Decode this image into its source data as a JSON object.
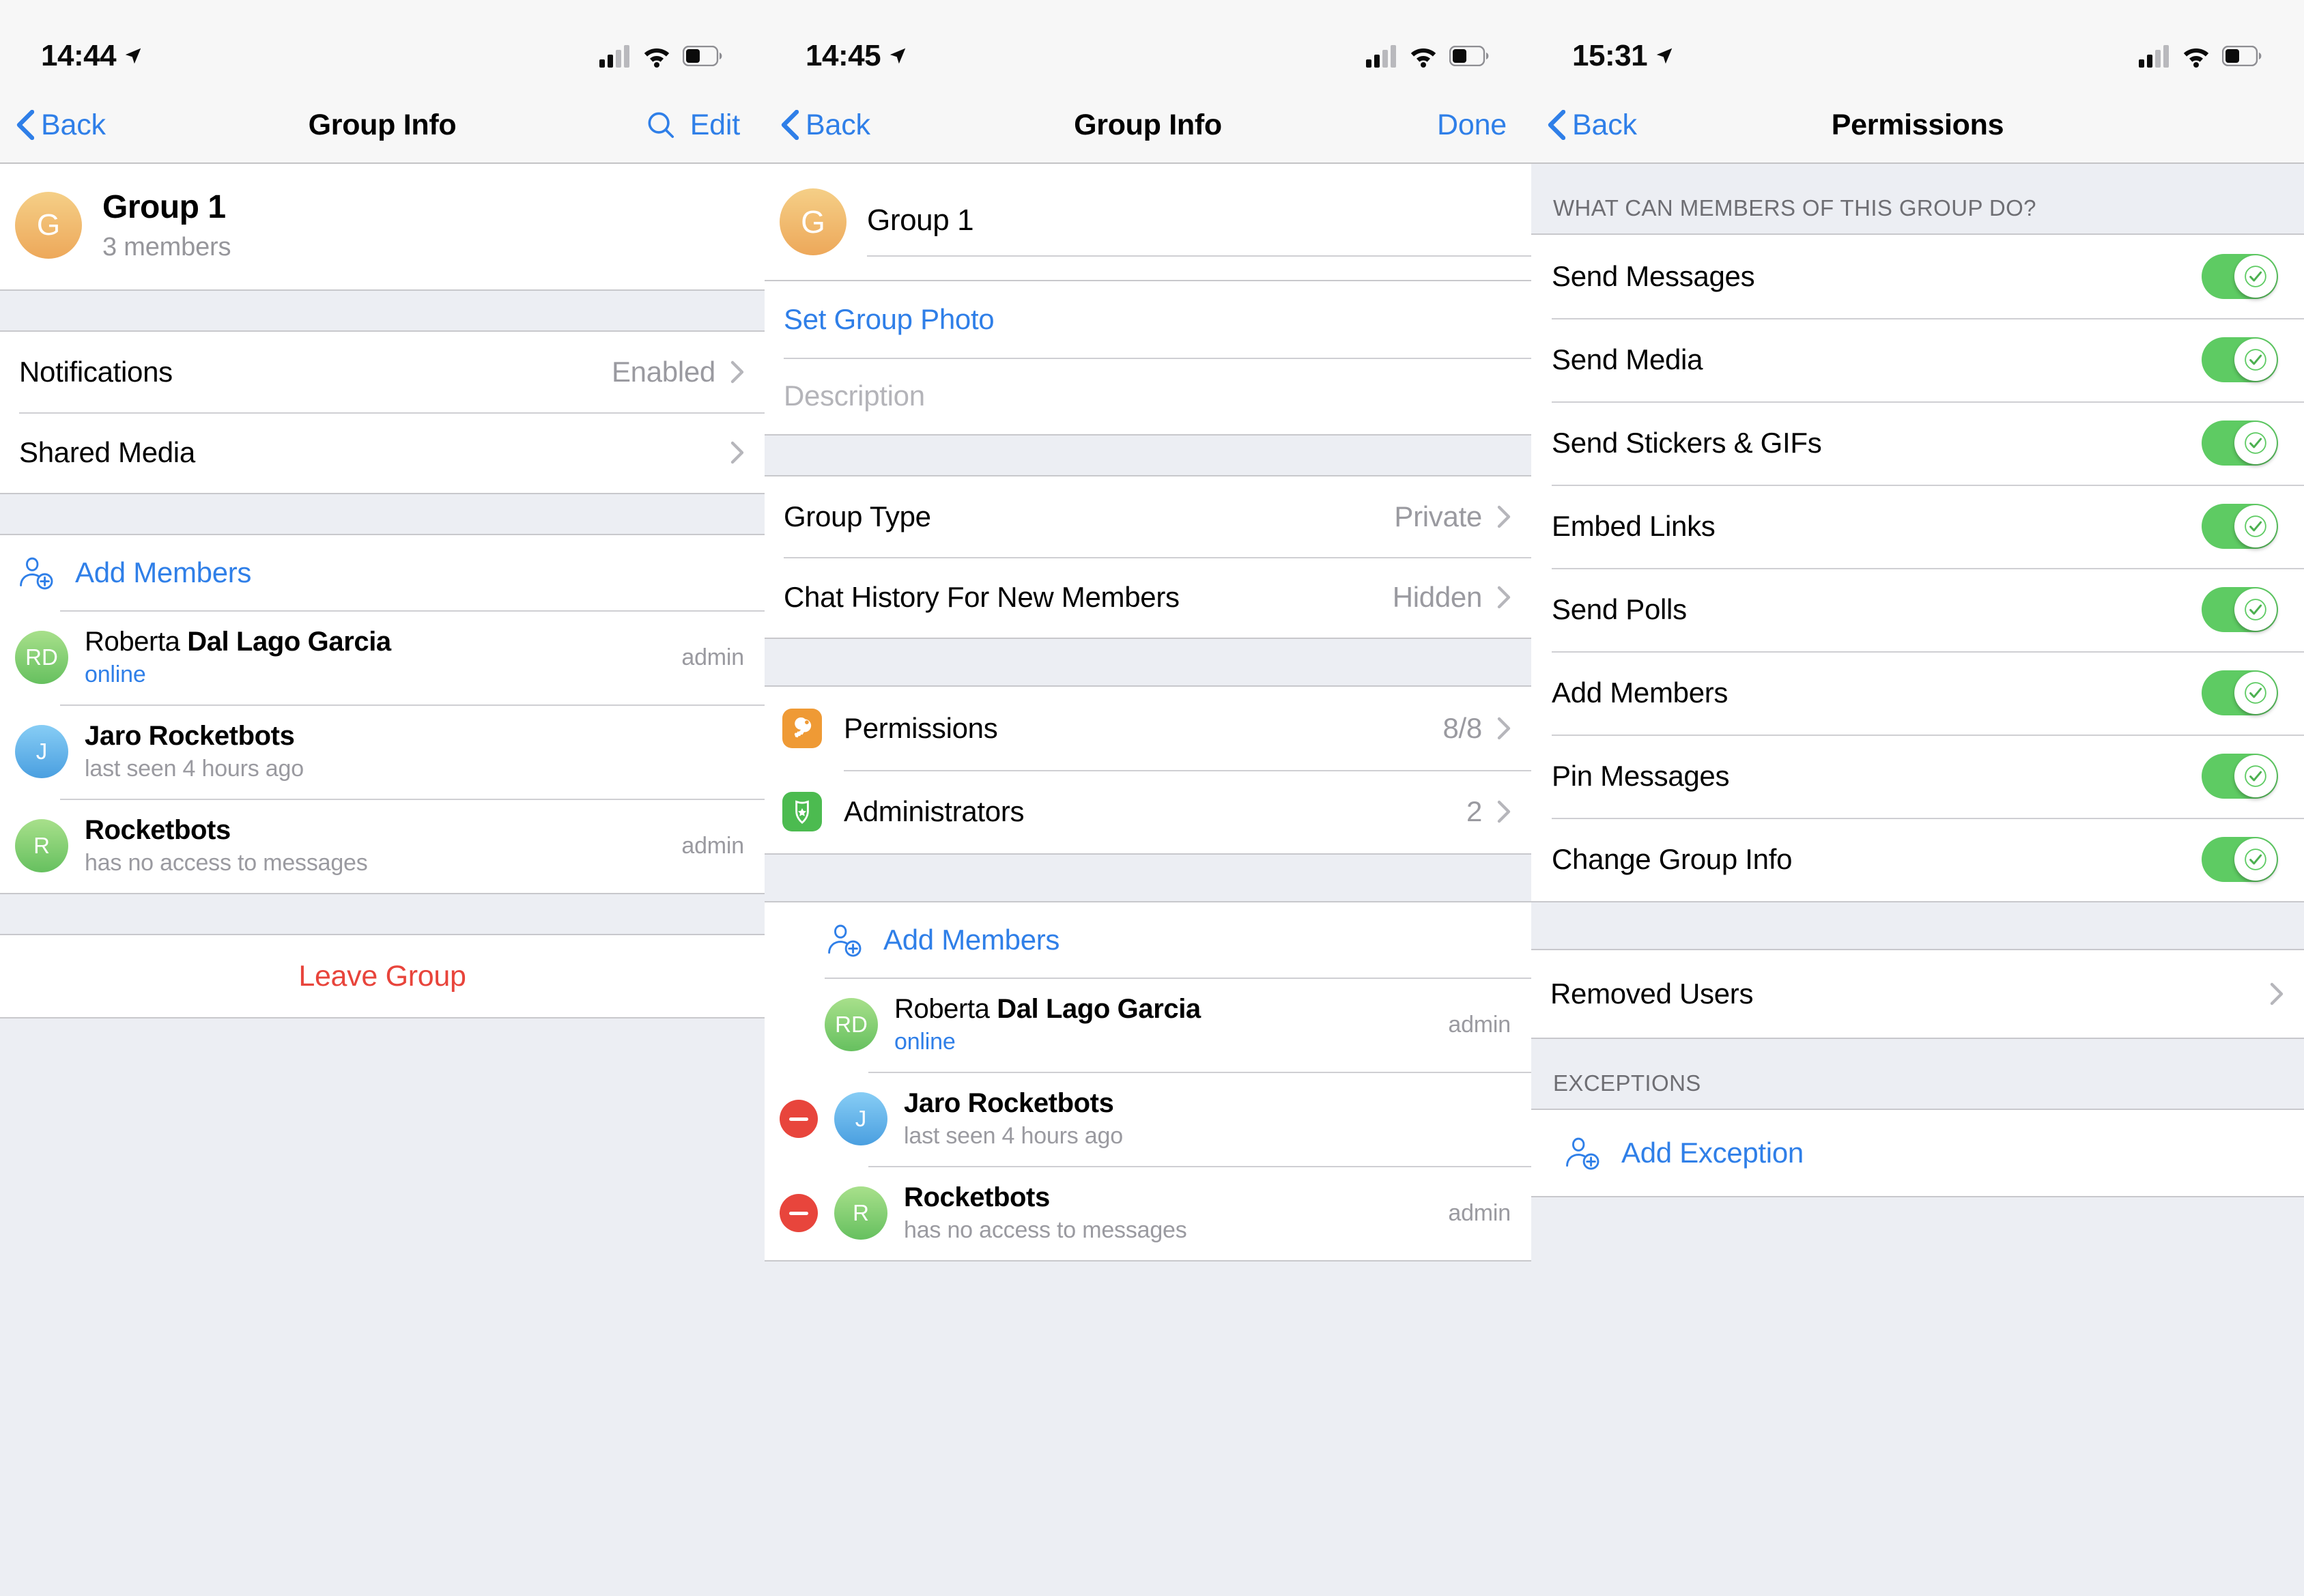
{
  "panels": [
    {
      "id": "group-info",
      "status": {
        "time": "14:44",
        "location_icon": "location-arrow-icon",
        "signal_icon": "cellular-signal-icon",
        "wifi_icon": "wifi-icon",
        "battery_icon": "battery-icon"
      },
      "nav": {
        "back_label": "Back",
        "title": "Group Info",
        "search_icon": "search-icon",
        "edit_label": "Edit"
      },
      "header": {
        "avatar_initial": "G",
        "title": "Group 1",
        "subtitle": "3 members"
      },
      "settings_rows": [
        {
          "label": "Notifications",
          "value": "Enabled",
          "chevron": true
        },
        {
          "label": "Shared Media",
          "value": "",
          "chevron": true
        }
      ],
      "add_members": {
        "icon": "add-user-icon",
        "label": "Add Members"
      },
      "members": [
        {
          "initials": "RD",
          "avatar_color": "green",
          "name_first": "Roberta ",
          "name_rest": "Dal Lago Garcia",
          "status": "online",
          "status_type": "online",
          "badge": "admin"
        },
        {
          "initials": "J",
          "avatar_color": "blue",
          "name_first": "Jaro Rocketbots",
          "name_rest": "",
          "status": "last seen 4 hours ago",
          "status_type": "muted",
          "badge": ""
        },
        {
          "initials": "R",
          "avatar_color": "green",
          "name_first": "Rocketbots",
          "name_rest": "",
          "status": "has no access to messages",
          "status_type": "muted",
          "badge": "admin"
        }
      ],
      "leave": {
        "label": "Leave Group"
      }
    },
    {
      "id": "group-info-edit",
      "status": {
        "time": "14:45",
        "location_icon": "location-arrow-icon",
        "signal_icon": "cellular-signal-icon",
        "wifi_icon": "wifi-icon",
        "battery_icon": "battery-icon"
      },
      "nav": {
        "back_label": "Back",
        "title": "Group Info",
        "done_label": "Done"
      },
      "header": {
        "avatar_initial": "G",
        "name_value": "Group 1"
      },
      "photo_row": {
        "label": "Set Group Photo"
      },
      "description_row": {
        "placeholder": "Description"
      },
      "settings_rows": [
        {
          "label": "Group Type",
          "value": "Private",
          "chevron": true
        },
        {
          "label": "Chat History For New Members",
          "value": "Hidden",
          "chevron": true
        }
      ],
      "admin_rows": [
        {
          "icon": "key-icon",
          "icon_color": "#ef9a35",
          "label": "Permissions",
          "value": "8/8",
          "chevron": true
        },
        {
          "icon": "shield-star-icon",
          "icon_color": "#4cbb50",
          "label": "Administrators",
          "value": "2",
          "chevron": true
        }
      ],
      "add_members": {
        "icon": "add-user-icon",
        "label": "Add Members"
      },
      "members": [
        {
          "initials": "RD",
          "avatar_color": "green",
          "name_first": "Roberta ",
          "name_rest": "Dal Lago Garcia",
          "status": "online",
          "status_type": "online",
          "badge": "admin",
          "deletable": false
        },
        {
          "initials": "J",
          "avatar_color": "blue",
          "name_first": "Jaro Rocketbots",
          "name_rest": "",
          "status": "last seen 4 hours ago",
          "status_type": "muted",
          "badge": "",
          "deletable": true
        },
        {
          "initials": "R",
          "avatar_color": "green",
          "name_first": "Rocketbots",
          "name_rest": "",
          "status": "has no access to messages",
          "status_type": "muted",
          "badge": "admin",
          "deletable": true
        }
      ]
    },
    {
      "id": "permissions",
      "status": {
        "time": "15:31",
        "location_icon": "location-arrow-icon",
        "signal_icon": "cellular-signal-icon",
        "wifi_icon": "wifi-icon",
        "battery_icon": "battery-icon"
      },
      "nav": {
        "back_label": "Back",
        "title": "Permissions"
      },
      "section_title": "WHAT CAN MEMBERS OF THIS GROUP DO?",
      "permissions": [
        {
          "label": "Send Messages",
          "enabled": true
        },
        {
          "label": "Send Media",
          "enabled": true
        },
        {
          "label": "Send Stickers & GIFs",
          "enabled": true
        },
        {
          "label": "Embed Links",
          "enabled": true
        },
        {
          "label": "Send Polls",
          "enabled": true
        },
        {
          "label": "Add Members",
          "enabled": true
        },
        {
          "label": "Pin Messages",
          "enabled": true
        },
        {
          "label": "Change Group Info",
          "enabled": true
        }
      ],
      "removed_users": {
        "label": "Removed Users",
        "chevron": true
      },
      "exceptions_title": "EXCEPTIONS",
      "add_exception": {
        "icon": "add-user-icon",
        "label": "Add Exception"
      }
    }
  ],
  "colors": {
    "accent_blue": "#2f7fe8",
    "destructive_red": "#e8443b",
    "toggle_green": "#5ecb63",
    "key_orange": "#ef9a35",
    "shield_green": "#4cbb50"
  }
}
